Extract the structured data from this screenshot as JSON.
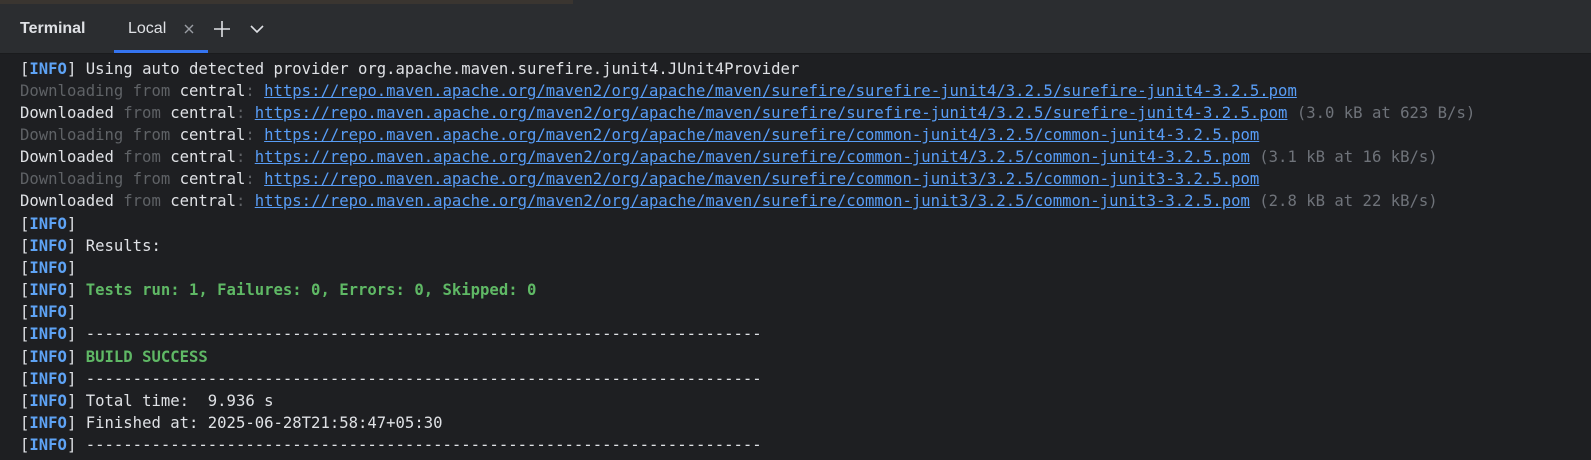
{
  "panel": {
    "title": "Terminal"
  },
  "tabs": [
    {
      "label": "Local"
    }
  ],
  "colors": {
    "background": "#1e1f22",
    "toolbar": "#2b2d30",
    "tab_underline": "#3574f0",
    "info_level": "#5ea3f5",
    "link": "#589df6",
    "success": "#5fb865",
    "dim": "#5f6266"
  },
  "icons": {
    "close": "close-icon",
    "add": "plus-icon",
    "menu": "chevron-down-icon"
  },
  "terminal": {
    "info_tag": "INFO",
    "provider_line": "Using auto detected provider org.apache.maven.surefire.junit4.JUnit4Provider",
    "downloading_word": "Downloading",
    "downloaded_word": "Downloaded",
    "from_word": "from",
    "repo_name": "central",
    "downloads": [
      {
        "url": "https://repo.maven.apache.org/maven2/org/apache/maven/surefire/surefire-junit4/3.2.5/surefire-junit4-3.2.5.pom",
        "stats": "(3.0 kB at 623 B/s)"
      },
      {
        "url": "https://repo.maven.apache.org/maven2/org/apache/maven/surefire/common-junit4/3.2.5/common-junit4-3.2.5.pom",
        "stats": "(3.1 kB at 16 kB/s)"
      },
      {
        "url": "https://repo.maven.apache.org/maven2/org/apache/maven/surefire/common-junit3/3.2.5/common-junit3-3.2.5.pom",
        "stats": "(2.8 kB at 22 kB/s)"
      }
    ],
    "results_label": "Results:",
    "tests_summary": "Tests run: 1, Failures: 0, Errors: 0, Skipped: 0",
    "separator": "------------------------------------------------------------------------",
    "build_status": "BUILD SUCCESS",
    "total_time": "Total time:  9.936 s",
    "finished_at": "Finished at: 2025-06-28T21:58:47+05:30"
  }
}
